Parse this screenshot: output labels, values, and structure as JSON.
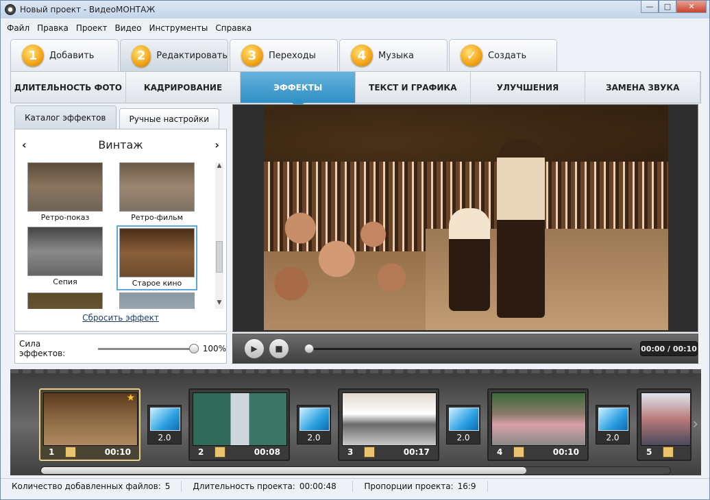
{
  "window": {
    "title": "Новый проект - ВидеоМОНТАЖ",
    "controls": [
      "—",
      "□",
      "✕"
    ]
  },
  "menu": [
    "Файл",
    "Правка",
    "Проект",
    "Видео",
    "Инструменты",
    "Справка"
  ],
  "steps": [
    {
      "num": "1",
      "label": "Добавить"
    },
    {
      "num": "2",
      "label": "Редактировать"
    },
    {
      "num": "3",
      "label": "Переходы"
    },
    {
      "num": "4",
      "label": "Музыка"
    },
    {
      "num": "✓",
      "label": "Создать"
    }
  ],
  "tabs": [
    "ДЛИТЕЛЬНОСТЬ ФОТО",
    "КАДРИРОВАНИЕ",
    "ЭФФЕКТЫ",
    "ТЕКСТ И ГРАФИКА",
    "УЛУЧШЕНИЯ",
    "ЗАМЕНА ЗВУКА"
  ],
  "left": {
    "subtabs": [
      "Каталог эффектов",
      "Ручные настройки"
    ],
    "category": "Винтаж",
    "prev": "‹",
    "next": "›",
    "effects": [
      "Ретро-показ",
      "Ретро-фильм",
      "Сепия",
      "Старое кино"
    ],
    "reset": "Сбросить эффект",
    "strength_label": "Сила эффектов:",
    "strength_value": "100%",
    "strength_level": 1.0
  },
  "player": {
    "time": "00:00 / 00:10",
    "play_icon": "▶",
    "stop_icon": "■",
    "progress": 0
  },
  "timeline": {
    "clips": [
      {
        "n": "1",
        "d": "00:10"
      },
      {
        "n": "2",
        "d": "00:08"
      },
      {
        "n": "3",
        "d": "00:17"
      },
      {
        "n": "4",
        "d": "00:10"
      },
      {
        "n": "5",
        "d": ""
      }
    ],
    "transitions": [
      "2.0",
      "2.0",
      "2.0",
      "2.0"
    ],
    "star": "★",
    "next": "›"
  },
  "status": {
    "files_label": "Количество добавленных файлов:",
    "files": "5",
    "duration_label": "Длительность проекта:",
    "duration": "00:00:48",
    "ratio_label": "Пропорции проекта:",
    "ratio": "16:9"
  },
  "colors": {
    "accent": "#3592c6",
    "badge": "#f3a316",
    "selected_clip": "#e9cf89"
  }
}
